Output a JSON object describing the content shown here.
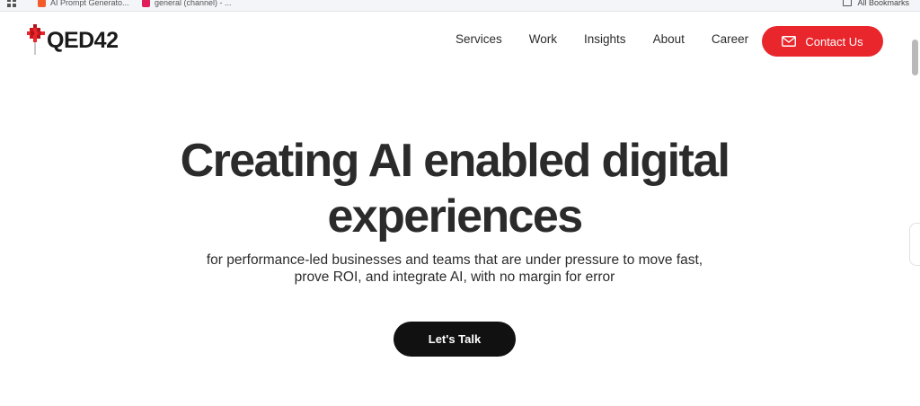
{
  "bookmarks_bar": {
    "items": [
      {
        "label": "AI Prompt Generato...",
        "icon": "orange-square-favicon",
        "color": "#f25c2a"
      },
      {
        "label": "general (channel) - ...",
        "icon": "slack-favicon",
        "color": "#e01e5a"
      }
    ],
    "right_label": "All Bookmarks"
  },
  "header": {
    "logo_text": "QED42",
    "nav": [
      "Services",
      "Work",
      "Insights",
      "About",
      "Career"
    ],
    "contact_label": "Contact Us"
  },
  "hero": {
    "title_line1": "Creating AI enabled digital",
    "title_line2": "experiences",
    "subtitle_line1": "for performance-led businesses and teams that are under pressure to move fast,",
    "subtitle_line2": "prove ROI, and integrate AI, with no margin for error",
    "cta_label": "Let's Talk"
  },
  "colors": {
    "brand_red": "#e8262c",
    "cta_black": "#111111",
    "text": "#2b2b2b"
  }
}
